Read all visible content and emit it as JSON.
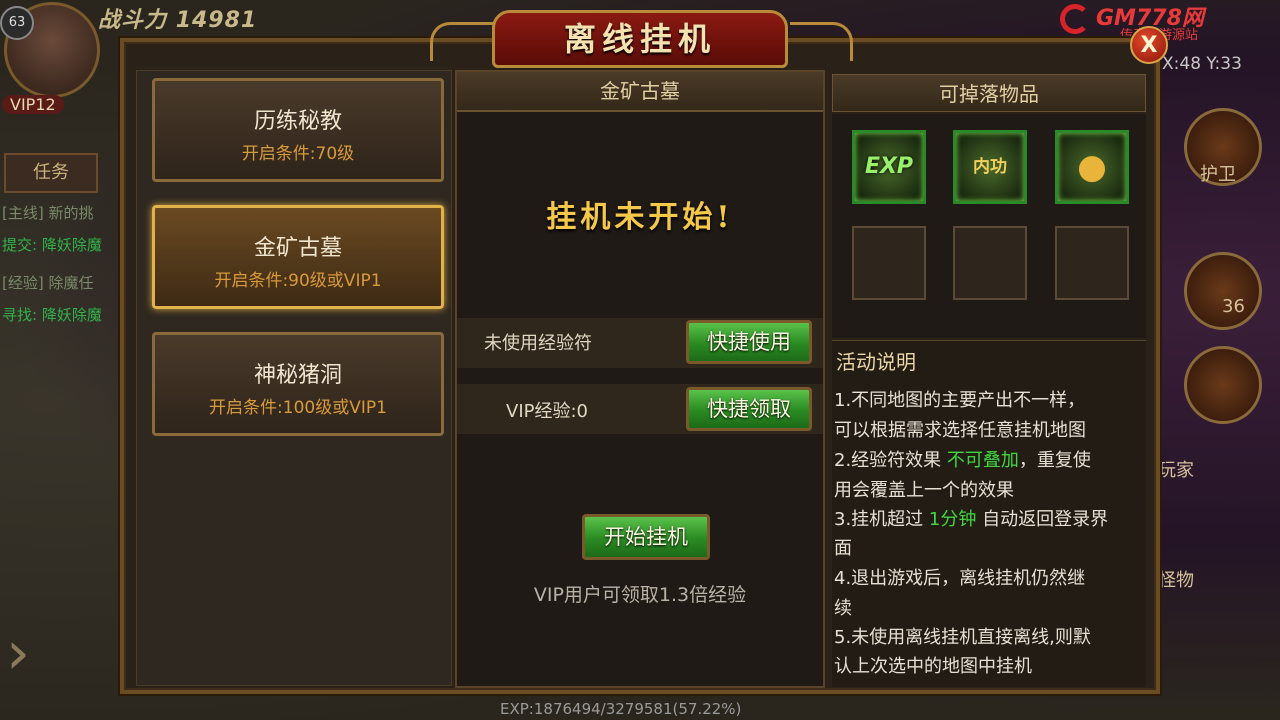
{
  "hud": {
    "power_label": "战斗力",
    "power_value": "14981",
    "level": "63",
    "vip": "VIP12",
    "task_tab": "任务",
    "quests": [
      "[主线] 新的挑",
      "提交: 降妖除魔",
      "[经验] 除魔任",
      "寻找: 降妖除魔"
    ],
    "coords": "X:48 Y:33",
    "side_labels": [
      "护卫",
      "36",
      "玩家",
      "怪物"
    ],
    "exp_text": "EXP:1876494/3279581(57.22%)"
  },
  "logo": {
    "line1": "GM778网",
    "line2": "传奇手游源站"
  },
  "dialog": {
    "title": "离线挂机",
    "close_label": "X"
  },
  "maps": [
    {
      "name": "历练秘教",
      "condition": "开启条件:70级",
      "selected": false
    },
    {
      "name": "金矿古墓",
      "condition": "开启条件:90级或VIP1",
      "selected": true
    },
    {
      "name": "神秘猪洞",
      "condition": "开启条件:100级或VIP1",
      "selected": false
    }
  ],
  "middle": {
    "map_title": "金矿古墓",
    "status": "挂机未开始!",
    "exp_rune_label": "未使用经验符",
    "exp_rune_button": "快捷使用",
    "vip_exp_label": "VIP经验:0",
    "vip_exp_button": "快捷领取",
    "start_button": "开始挂机",
    "vip_note": "VIP用户可领取1.3倍经验"
  },
  "drops": {
    "title": "可掉落物品",
    "items": [
      {
        "icon": "exp-icon",
        "label": "EXP"
      },
      {
        "icon": "neigong-icon",
        "label": "内功"
      },
      {
        "icon": "gold-coins-icon",
        "label": ""
      },
      {
        "icon": "empty-slot",
        "label": ""
      },
      {
        "icon": "empty-slot",
        "label": ""
      },
      {
        "icon": "empty-slot",
        "label": ""
      }
    ]
  },
  "description": {
    "title": "活动说明",
    "line1": "1.不同地图的主要产出不一样，",
    "line2": "可以根据需求选择任意挂机地图",
    "line3a": "2.经验符效果 ",
    "line3b": "不可叠加",
    "line3c": "，重复使",
    "line4": "用会覆盖上一个的效果",
    "line5a": "3.挂机超过 ",
    "line5b": "1分钟",
    "line5c": " 自动返回登录界",
    "line6": "面",
    "line7": "4.退出游戏后，离线挂机仍然继",
    "line8": "续",
    "line9": "5.未使用离线挂机直接离线,则默",
    "line10": "认上次选中的地图中挂机"
  },
  "colors": {
    "highlight": "#3ed83e",
    "button_green": "#2a8a22",
    "gold_border": "#b88b3a"
  }
}
